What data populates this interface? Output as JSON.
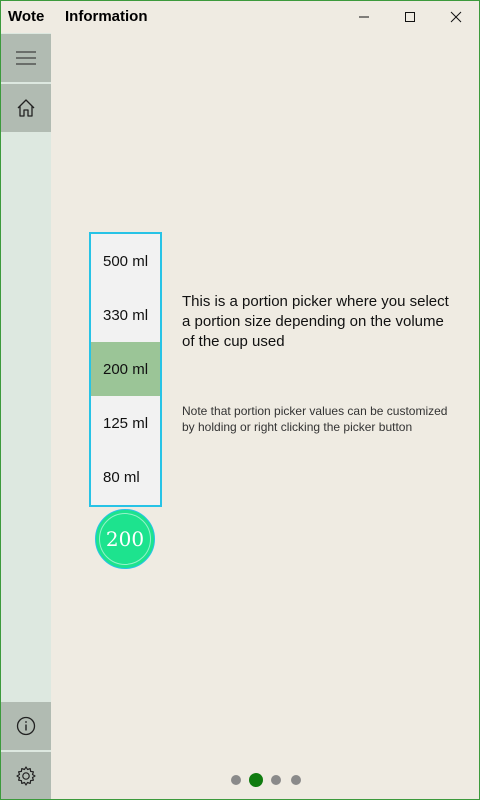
{
  "titlebar": {
    "app_name": "Wote",
    "page_title": "Information"
  },
  "sidebar": {
    "items": [
      {
        "icon": "hamburger-menu-icon"
      },
      {
        "icon": "home-icon"
      },
      {
        "icon": "info-icon"
      },
      {
        "icon": "gear-icon"
      }
    ]
  },
  "picker": {
    "options": [
      "500 ml",
      "330 ml",
      "200 ml",
      "125 ml",
      "80 ml"
    ],
    "selected_index": 2
  },
  "portion_button": {
    "value": "200"
  },
  "info": {
    "description": "This is a portion picker where you select a portion size depending on the volume of the cup used",
    "note": "Note that portion picker values can be customized by holding or right clicking the picker button"
  },
  "pager": {
    "count": 4,
    "active_index": 1
  },
  "colors": {
    "accent": "#107c10",
    "picker_border": "#27c3e6",
    "selected_bg": "#9bc597",
    "portion_fill": "#1de38e",
    "window_border": "#3c9a3c"
  }
}
